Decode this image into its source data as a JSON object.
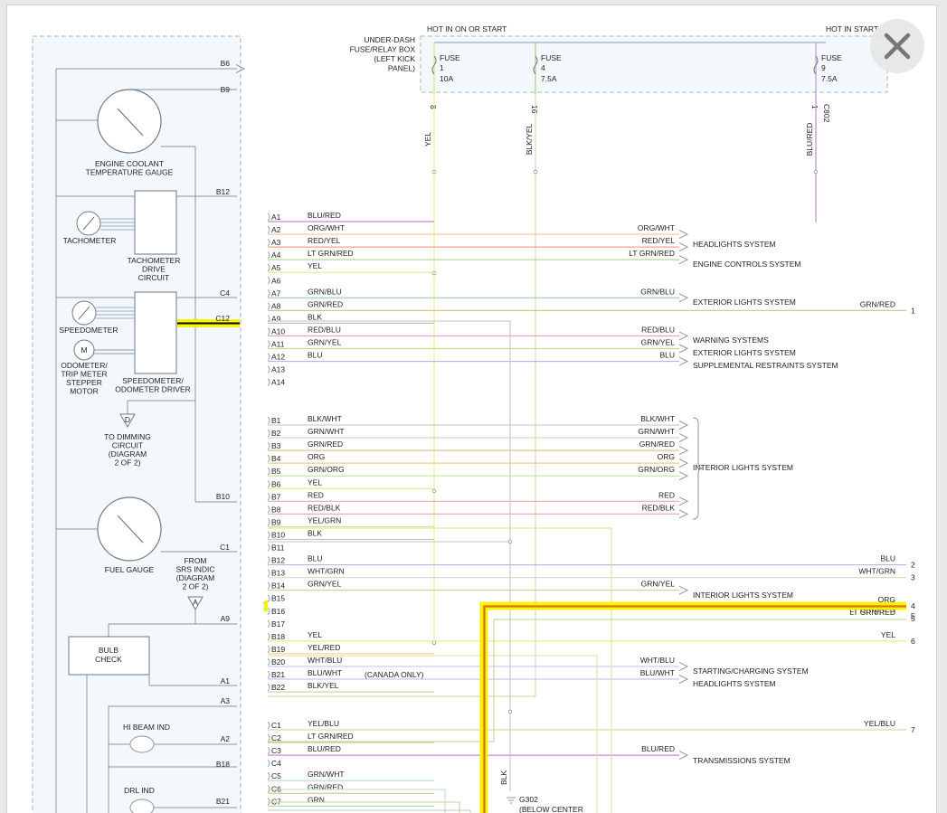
{
  "colors": {
    "page_bg": "#e7e8ea",
    "box_fill": "#f3f8fc",
    "box_border": "#a8b4bf",
    "highlight": "#f5f500",
    "highlight_wire": "#e89a1a"
  },
  "close_icon": "close-icon",
  "header": {
    "hot_run": "HOT IN ON OR START",
    "hot_start": "HOT IN START",
    "fuse_box_lines": [
      "UNDER-DASH",
      "FUSE/RELAY BOX",
      "(LEFT KICK",
      "PANEL)"
    ],
    "connector_c802": "C802"
  },
  "fuses": [
    {
      "label": "FUSE",
      "num": "1",
      "amp": "10A",
      "pin": "8",
      "wire": "YEL",
      "color": "#e9e05a"
    },
    {
      "label": "FUSE",
      "num": "4",
      "amp": "7.5A",
      "pin": "16",
      "wire": "BLK/YEL",
      "color": "#b9bf7a"
    },
    {
      "label": "FUSE",
      "num": "9",
      "amp": "7.5A",
      "pin": "1",
      "wire": "BLU/RED",
      "color": "#c58ad3"
    }
  ],
  "components": {
    "b6": "B6",
    "b9": "B9",
    "ect_gauge": [
      "ENGINE COOLANT",
      "TEMPERATURE GAUGE"
    ],
    "b12": "B12",
    "tachometer": "TACHOMETER",
    "tach_drive": [
      "TACHOMETER",
      "DRIVE",
      "CIRCUIT"
    ],
    "c4": "C4",
    "c12": "C12",
    "speedometer": "SPEEDOMETER",
    "motor_symbol": "M",
    "odometer_motor": [
      "ODOMETER/",
      "TRIP METER",
      "STEPPER",
      "MOTOR"
    ],
    "speedo_driver": [
      "SPEEDOMETER/",
      "ODOMETER DRIVER"
    ],
    "dimming_symbol": "D",
    "dimming_text": [
      "TO DIMMING",
      "CIRCUIT",
      "(DIAGRAM",
      "2 OF 2)"
    ],
    "b10": "B10",
    "fuel_gauge": "FUEL GAUGE",
    "c1": "C1",
    "srs_text": [
      "FROM",
      "SRS INDIC",
      "(DIAGRAM",
      "2 OF 2)"
    ],
    "srs_symbol": "A",
    "a9": "A9",
    "bulb_check": [
      "BULB",
      "CHECK"
    ],
    "a1": "A1",
    "a3": "A3",
    "hi_beam": "HI BEAM IND",
    "a2": "A2",
    "b18": "B18",
    "drl": "DRL IND",
    "b21": "B21"
  },
  "connectors": [
    {
      "pin": "A1",
      "wire": "BLU/RED",
      "color": "#c58ad3"
    },
    {
      "pin": "A2",
      "wire": "ORG/WHT",
      "color": "#f2c79a",
      "right": "ORG/WHT",
      "arrow": true
    },
    {
      "pin": "A3",
      "wire": "RED/YEL",
      "color": "#efa28f",
      "right": "RED/YEL",
      "arrow": true
    },
    {
      "pin": "A4",
      "wire": "LT GRN/RED",
      "color": "#bed58f",
      "right": "LT GRN/RED",
      "arrow": true
    },
    {
      "pin": "A5",
      "wire": "YEL",
      "color": "#efe88a"
    },
    {
      "pin": "A6",
      "wire": ""
    },
    {
      "pin": "A7",
      "wire": "GRN/BLU",
      "color": "#9fcdb3",
      "right": "GRN/BLU",
      "arrow": true
    },
    {
      "pin": "A8",
      "wire": "GRN/RED",
      "color": "#d6c792",
      "right": "GRN/RED",
      "term": "1"
    },
    {
      "pin": "A9",
      "wire": "BLK",
      "color": "#c2c2c2"
    },
    {
      "pin": "A10",
      "wire": "RED/BLU",
      "color": "#d9a3cf",
      "right": "RED/BLU",
      "arrow": true
    },
    {
      "pin": "A11",
      "wire": "GRN/YEL",
      "color": "#c9da95",
      "right": "GRN/YEL",
      "arrow": true
    },
    {
      "pin": "A12",
      "wire": "BLU",
      "color": "#b8b4e6",
      "right": "BLU",
      "arrow": true
    },
    {
      "pin": "A13",
      "wire": ""
    },
    {
      "pin": "A14",
      "wire": ""
    },
    {
      "pin": "B1",
      "wire": "BLK/WHT",
      "color": "#cfcfcf",
      "right": "BLK/WHT",
      "arrow": true
    },
    {
      "pin": "B2",
      "wire": "GRN/WHT",
      "color": "#b9ddbf",
      "right": "GRN/WHT",
      "arrow": true
    },
    {
      "pin": "B3",
      "wire": "GRN/RED",
      "color": "#d6c792",
      "right": "GRN/RED",
      "arrow": true
    },
    {
      "pin": "B4",
      "wire": "ORG",
      "color": "#f6c98a",
      "right": "ORG",
      "arrow": true
    },
    {
      "pin": "B5",
      "wire": "GRN/ORG",
      "color": "#cddf9b",
      "right": "GRN/ORG",
      "arrow": true
    },
    {
      "pin": "B6",
      "wire": "YEL",
      "color": "#efe88a"
    },
    {
      "pin": "B7",
      "wire": "RED",
      "color": "#efa7a0",
      "right": "RED",
      "arrow": true
    },
    {
      "pin": "B8",
      "wire": "RED/BLK",
      "color": "#e4b1b6",
      "right": "RED/BLK",
      "arrow": true
    },
    {
      "pin": "B9",
      "wire": "YEL/GRN",
      "color": "#d6e38d"
    },
    {
      "pin": "B10",
      "wire": "BLK",
      "color": "#c2c2c2"
    },
    {
      "pin": "B11",
      "wire": ""
    },
    {
      "pin": "B12",
      "wire": "BLU",
      "color": "#b8b4e6",
      "right": "BLU",
      "term": "2"
    },
    {
      "pin": "B13",
      "wire": "WHT/GRN",
      "color": "#cce3c9",
      "right": "WHT/GRN",
      "term": "3"
    },
    {
      "pin": "B14",
      "wire": "GRN/YEL",
      "color": "#c9da95",
      "right": "GRN/YEL",
      "arrow": true
    },
    {
      "pin": "B15",
      "wire": "",
      "right": "ORG",
      "term": "4",
      "highlight": true
    },
    {
      "pin": "B16",
      "wire": "",
      "right": "LT GRN/RED",
      "term": "5"
    },
    {
      "pin": "B17",
      "wire": ""
    },
    {
      "pin": "B18",
      "wire": "YEL",
      "color": "#efe88a",
      "right": "YEL",
      "term": "6"
    },
    {
      "pin": "B19",
      "wire": "YEL/RED",
      "color": "#f0d49a"
    },
    {
      "pin": "B20",
      "wire": "WHT/BLU",
      "color": "#c9c7ef",
      "right": "WHT/BLU",
      "arrow": true
    },
    {
      "pin": "B21",
      "wire": "BLU/WHT",
      "color": "#c6c2ec",
      "right": "BLU/WHT",
      "arrow": true,
      "note": "(CANADA ONLY)"
    },
    {
      "pin": "B22",
      "wire": "BLK/YEL",
      "color": "#ccd09a"
    },
    {
      "pin": "C1",
      "wire": "YEL/BLU",
      "color": "#d8dba8",
      "right": "YEL/BLU",
      "term": "7"
    },
    {
      "pin": "C2",
      "wire": "LT GRN/RED",
      "color": "#bed58f"
    },
    {
      "pin": "C3",
      "wire": "BLU/RED",
      "color": "#c58ad3",
      "right": "BLU/RED",
      "arrow": true
    },
    {
      "pin": "C4",
      "wire": ""
    },
    {
      "pin": "C5",
      "wire": "GRN/WHT",
      "color": "#b9ddbf"
    },
    {
      "pin": "C6",
      "wire": "GRN/RED",
      "color": "#d6c792"
    },
    {
      "pin": "C7",
      "wire": "GRN",
      "color": "#a9d8a9"
    }
  ],
  "systems": [
    {
      "text": "HEADLIGHTS SYSTEM"
    },
    {
      "text": "ENGINE CONTROLS SYSTEM"
    },
    {
      "text": "EXTERIOR LIGHTS SYSTEM"
    },
    {
      "text": "WARNING SYSTEMS"
    },
    {
      "text": "EXTERIOR LIGHTS SYSTEM"
    },
    {
      "text": "SUPPLEMENTAL RESTRAINTS SYSTEM"
    },
    {
      "text": "INTERIOR LIGHTS SYSTEM"
    },
    {
      "text": "INTERIOR LIGHTS SYSTEM"
    },
    {
      "text": "STARTING/CHARGING SYSTEM"
    },
    {
      "text": "HEADLIGHTS SYSTEM"
    },
    {
      "text": "TRANSMISSIONS SYSTEM"
    }
  ],
  "ground": {
    "wire": "BLK",
    "name": "G302",
    "note": "(BELOW CENTER"
  }
}
